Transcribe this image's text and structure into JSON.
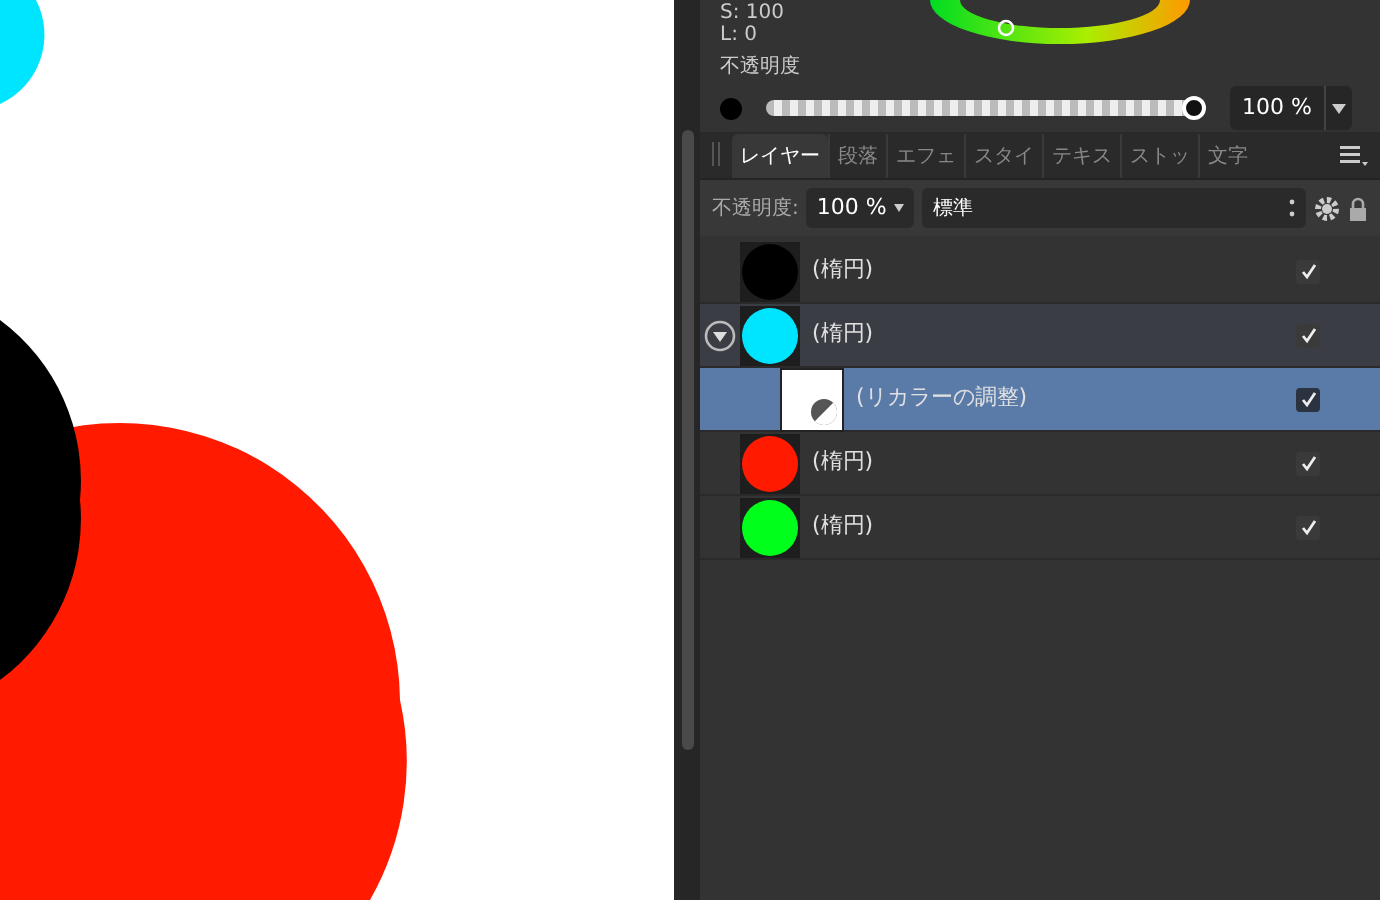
{
  "color_panel": {
    "readouts": [
      "S: 100",
      "L: 0"
    ],
    "opacity_label": "不透明度",
    "opacity": {
      "level": 1,
      "value": "100 %"
    }
  },
  "layers_panel": {
    "tabs": [
      {
        "label": "レイヤー",
        "selected": true
      },
      {
        "label": "段落",
        "selected": false
      },
      {
        "label": "エフェ",
        "selected": false
      },
      {
        "label": "スタイ",
        "selected": false
      },
      {
        "label": "テキス",
        "selected": false
      },
      {
        "label": "ストッ",
        "selected": false
      },
      {
        "label": "文字",
        "selected": false
      }
    ],
    "opacity_label": "不透明度:",
    "opacity_value": "100 %",
    "blend_mode": "標準",
    "layers": [
      {
        "kind": "shape",
        "name": "(楕円)",
        "color": "#000000",
        "visible": true,
        "selected": false
      },
      {
        "kind": "shape",
        "name": "(楕円)",
        "color": "#00e5ff",
        "visible": true,
        "selected": false,
        "expanded": true,
        "children": [
          {
            "kind": "adjustment",
            "name": "(リカラーの調整)",
            "visible": true,
            "selected": true
          }
        ]
      },
      {
        "kind": "shape",
        "name": "(楕円)",
        "color": "#ff1a00",
        "visible": true,
        "selected": false
      },
      {
        "kind": "shape",
        "name": "(楕円)",
        "color": "#00ff1a",
        "visible": true,
        "selected": false
      }
    ]
  }
}
